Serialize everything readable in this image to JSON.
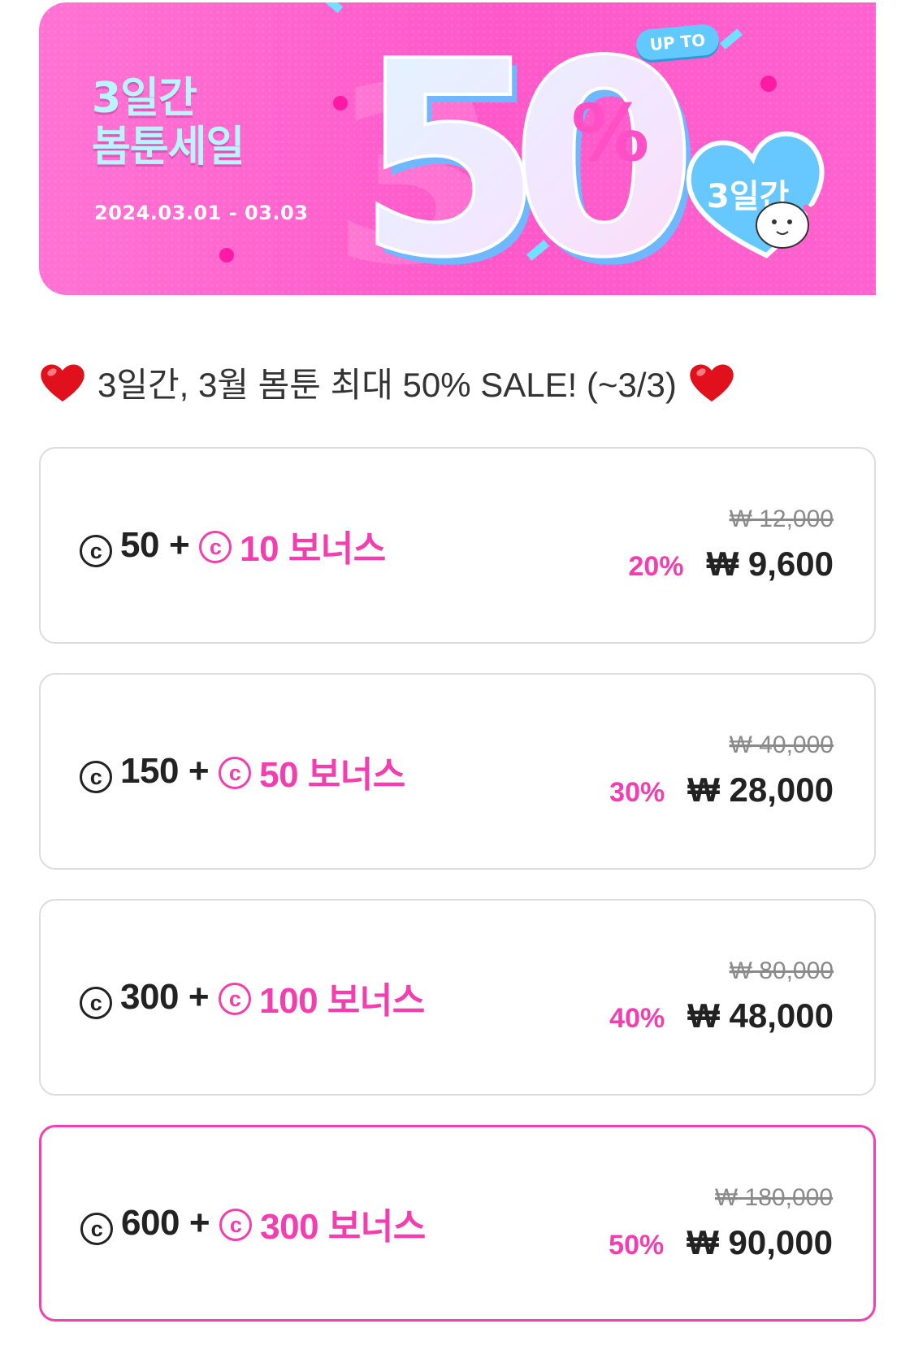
{
  "banner": {
    "title_line1": "3일간",
    "title_line2": "봄툰세일",
    "date_range": "2024.03.01 - 03.03",
    "big_number": "50",
    "percent_sign": "%",
    "upto_label": "UP TO",
    "badge_label": "3일간",
    "colors": {
      "background": "#ff5acb",
      "title": "#b9f5ff",
      "accent_blue": "#62c9ff"
    }
  },
  "headline": {
    "text": "3일간, 3월 봄툰 최대 50% SALE! (~3/3)",
    "left_icon": "red-heart-icon",
    "right_icon": "red-heart-icon"
  },
  "coin_symbol": "c",
  "products": [
    {
      "base": "50",
      "plus": "+",
      "bonus": "10 보너스",
      "original_price": "₩ 12,000",
      "discount": "20%",
      "price": "₩ 9,600",
      "selected": false
    },
    {
      "base": "150",
      "plus": "+",
      "bonus": "50 보너스",
      "original_price": "₩ 40,000",
      "discount": "30%",
      "price": "₩ 28,000",
      "selected": false
    },
    {
      "base": "300",
      "plus": "+",
      "bonus": "100 보너스",
      "original_price": "₩ 80,000",
      "discount": "40%",
      "price": "₩ 48,000",
      "selected": false
    },
    {
      "base": "600",
      "plus": "+",
      "bonus": "300 보너스",
      "original_price": "₩ 180,000",
      "discount": "50%",
      "price": "₩ 90,000",
      "selected": true
    }
  ],
  "colors": {
    "accent": "#f23eae",
    "text": "#222222",
    "muted": "#8a8a8a",
    "card_border": "#dcdcdc"
  }
}
